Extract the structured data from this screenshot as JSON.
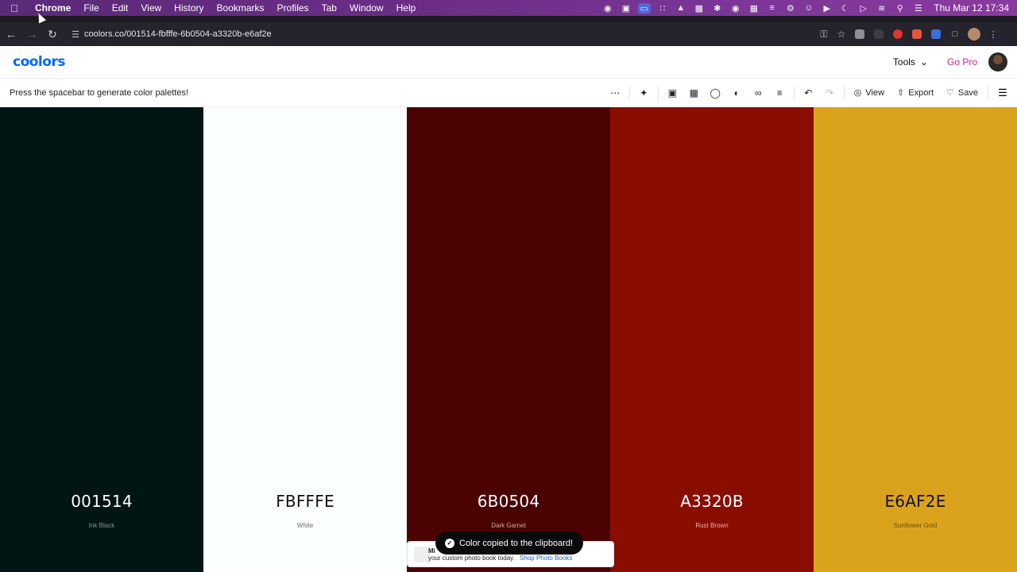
{
  "menubar": {
    "app": "Chrome",
    "items": [
      "File",
      "Edit",
      "View",
      "History",
      "Bookmarks",
      "Profiles",
      "Tab",
      "Window",
      "Help"
    ],
    "clock": "Thu Mar 12  17:34"
  },
  "browser": {
    "url": "coolors.co/001514-fbfffe-6b0504-a3320b-e6af2e"
  },
  "site": {
    "logo": "coolors",
    "tools_label": "Tools",
    "gopro_label": "Go Pro"
  },
  "generator": {
    "hint": "Press the spacebar to generate color palettes!",
    "view_label": "View",
    "export_label": "Export",
    "save_label": "Save"
  },
  "palette": [
    {
      "hex": "001514",
      "name": "Ink Black",
      "bg": "#001514",
      "fg": "#ffffff",
      "sub": "#8a8f8f"
    },
    {
      "hex": "FBFFFE",
      "name": "White",
      "bg": "#FBFFFE",
      "fg": "#111111",
      "sub": "#666666"
    },
    {
      "hex": "6B0504",
      "name": "Dark Garnet",
      "bg": "#4a0302",
      "fg": "#ffffff",
      "sub": "#d3a5a3"
    },
    {
      "hex": "A3320B",
      "name": "Rust Brown",
      "bg": "#8a0d02",
      "fg": "#ffffff",
      "sub": "#e7b4a9"
    },
    {
      "hex": "E6AF2E",
      "name": "Sunflower Gold",
      "bg": "#dba31c",
      "fg": "#111111",
      "sub": "#6b4e0f"
    }
  ],
  "toast": {
    "message": "Color copied to the clipboard!"
  },
  "ad": {
    "line1": "Mi",
    "line2": "your custom photo book today.",
    "cta": "Shop Photo Books"
  }
}
